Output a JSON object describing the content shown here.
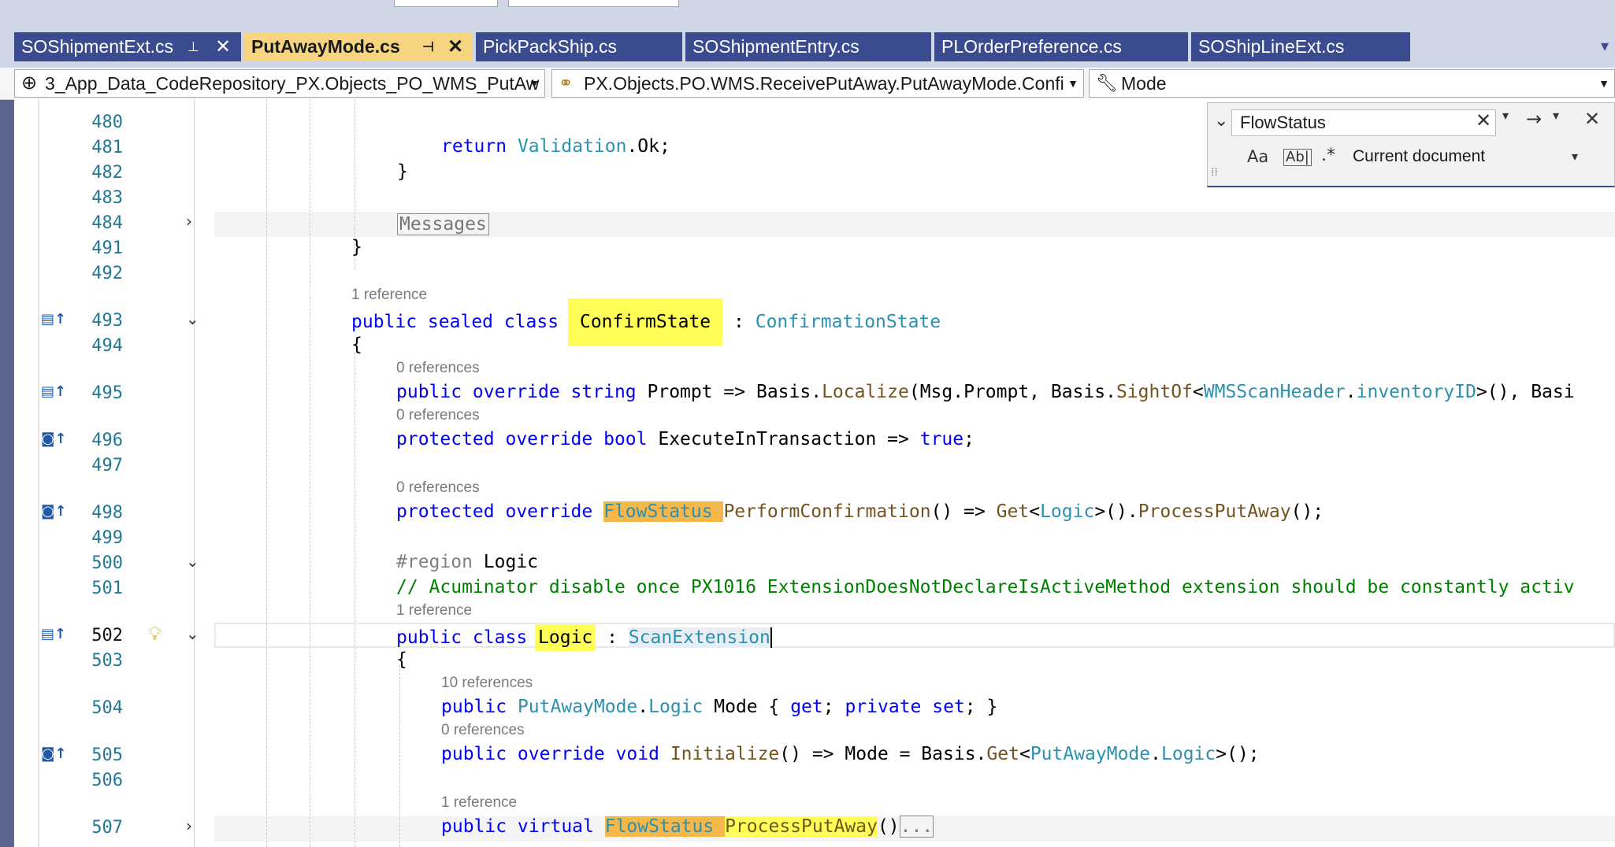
{
  "tabs": [
    {
      "label": "SOShipmentExt.cs",
      "pin": "⊥",
      "close": "✕",
      "active": false
    },
    {
      "label": "PutAwayMode.cs",
      "pin": "⊣",
      "close": "✕",
      "active": true
    },
    {
      "label": "PickPackShip.cs",
      "active": false
    },
    {
      "label": "SOShipmentEntry.cs",
      "active": false
    },
    {
      "label": "PLOrderPreference.cs",
      "active": false
    },
    {
      "label": "SOShipLineExt.cs",
      "active": false
    }
  ],
  "navbar": {
    "project": "3_App_Data_CodeRepository_PX.Objects_PO_WMS_PutAw",
    "type": "PX.Objects.PO.WMS.ReceivePutAway.PutAwayMode.Confi",
    "member": "Mode"
  },
  "find": {
    "query": "FlowStatus",
    "scope": "Current document",
    "match_case": "Aa",
    "whole_word": "Ab|"
  },
  "lines": {
    "l480": "480",
    "l481": "481",
    "l482": "482",
    "l483": "483",
    "l484": "484",
    "l491": "491",
    "l492": "492",
    "l493": "493",
    "l494": "494",
    "l495": "495",
    "l496": "496",
    "l497": "497",
    "l498": "498",
    "l499": "499",
    "l500": "500",
    "l501": "501",
    "l502": "502",
    "l503": "503",
    "l504": "504",
    "l505": "505",
    "l506": "506",
    "l507": "507"
  },
  "lens": {
    "r1": "1 reference",
    "r0a": "0 references",
    "r0b": "0 references",
    "r0c": "0 references",
    "r1b": "1 reference",
    "r10": "10 references",
    "r0d": "0 references",
    "r1c": "1 reference"
  },
  "code": {
    "c481_kw": "return",
    "c481_ty": "Validation",
    "c481_rest": ".Ok;",
    "c482": "}",
    "c484": "Messages",
    "c491": "}",
    "c493_kw": "public sealed class",
    "c493_name": "ConfirmState",
    "c493_colon": ":",
    "c493_base": "ConfirmationState",
    "c494": "{",
    "c495_kw": "public override string",
    "c495_a": "Prompt => Basis.",
    "c495_m": "Localize",
    "c495_b": "(Msg.Prompt, Basis.",
    "c495_m2": "SightOf",
    "c495_c": "<",
    "c495_t": "WMSScanHeader",
    "c495_d": ".",
    "c495_t2": "inventoryID",
    "c495_e": ">(), Basi",
    "c496_kw": "protected override bool",
    "c496_a": "ExecuteInTransaction =>",
    "c496_kw2": "true",
    "c496_b": ";",
    "c498_kw": "protected override",
    "c498_ty": "FlowStatus",
    "c498_m": "PerformConfirmation",
    "c498_a": "() =>",
    "c498_m2": "Get",
    "c498_b": "<",
    "c498_t": "Logic",
    "c498_c": ">().",
    "c498_m3": "ProcessPutAway",
    "c498_d": "();",
    "c500_kw": "#region",
    "c500_a": "Logic",
    "c501": "// Acuminator disable once PX1016 ExtensionDoesNotDeclareIsActiveMethod extension should be constantly activ",
    "c502_kw": "public class",
    "c502_name": "Logic",
    "c502_colon": ":",
    "c502_base": "ScanExtension",
    "c503": "{",
    "c504_kw": "public",
    "c504_ty": "PutAwayMode",
    "c504_d": ".",
    "c504_ty2": "Logic",
    "c504_a": "Mode {",
    "c504_kw2": "get",
    "c504_b": ";",
    "c504_kw3": "private set",
    "c504_c": "; }",
    "c505_kw": "public override void",
    "c505_m": "Initialize",
    "c505_a": "() => Mode = Basis.",
    "c505_m2": "Get",
    "c505_b": "<",
    "c505_t": "PutAwayMode",
    "c505_d": ".",
    "c505_t2": "Logic",
    "c505_c": ">();",
    "c507_kw": "public virtual",
    "c507_ty": "FlowStatus",
    "c507_m": "ProcessPutAway",
    "c507_a": "()",
    "c507_b": "..."
  },
  "colors": {
    "tab_bg": "#3b4b8f",
    "tab_active": "#f7d580",
    "keyword": "#0000ff",
    "type": "#2b91af",
    "method": "#74531f",
    "comment": "#008000",
    "highlight_yellow": "#ffff57",
    "highlight_orange": "#f5b74a"
  }
}
